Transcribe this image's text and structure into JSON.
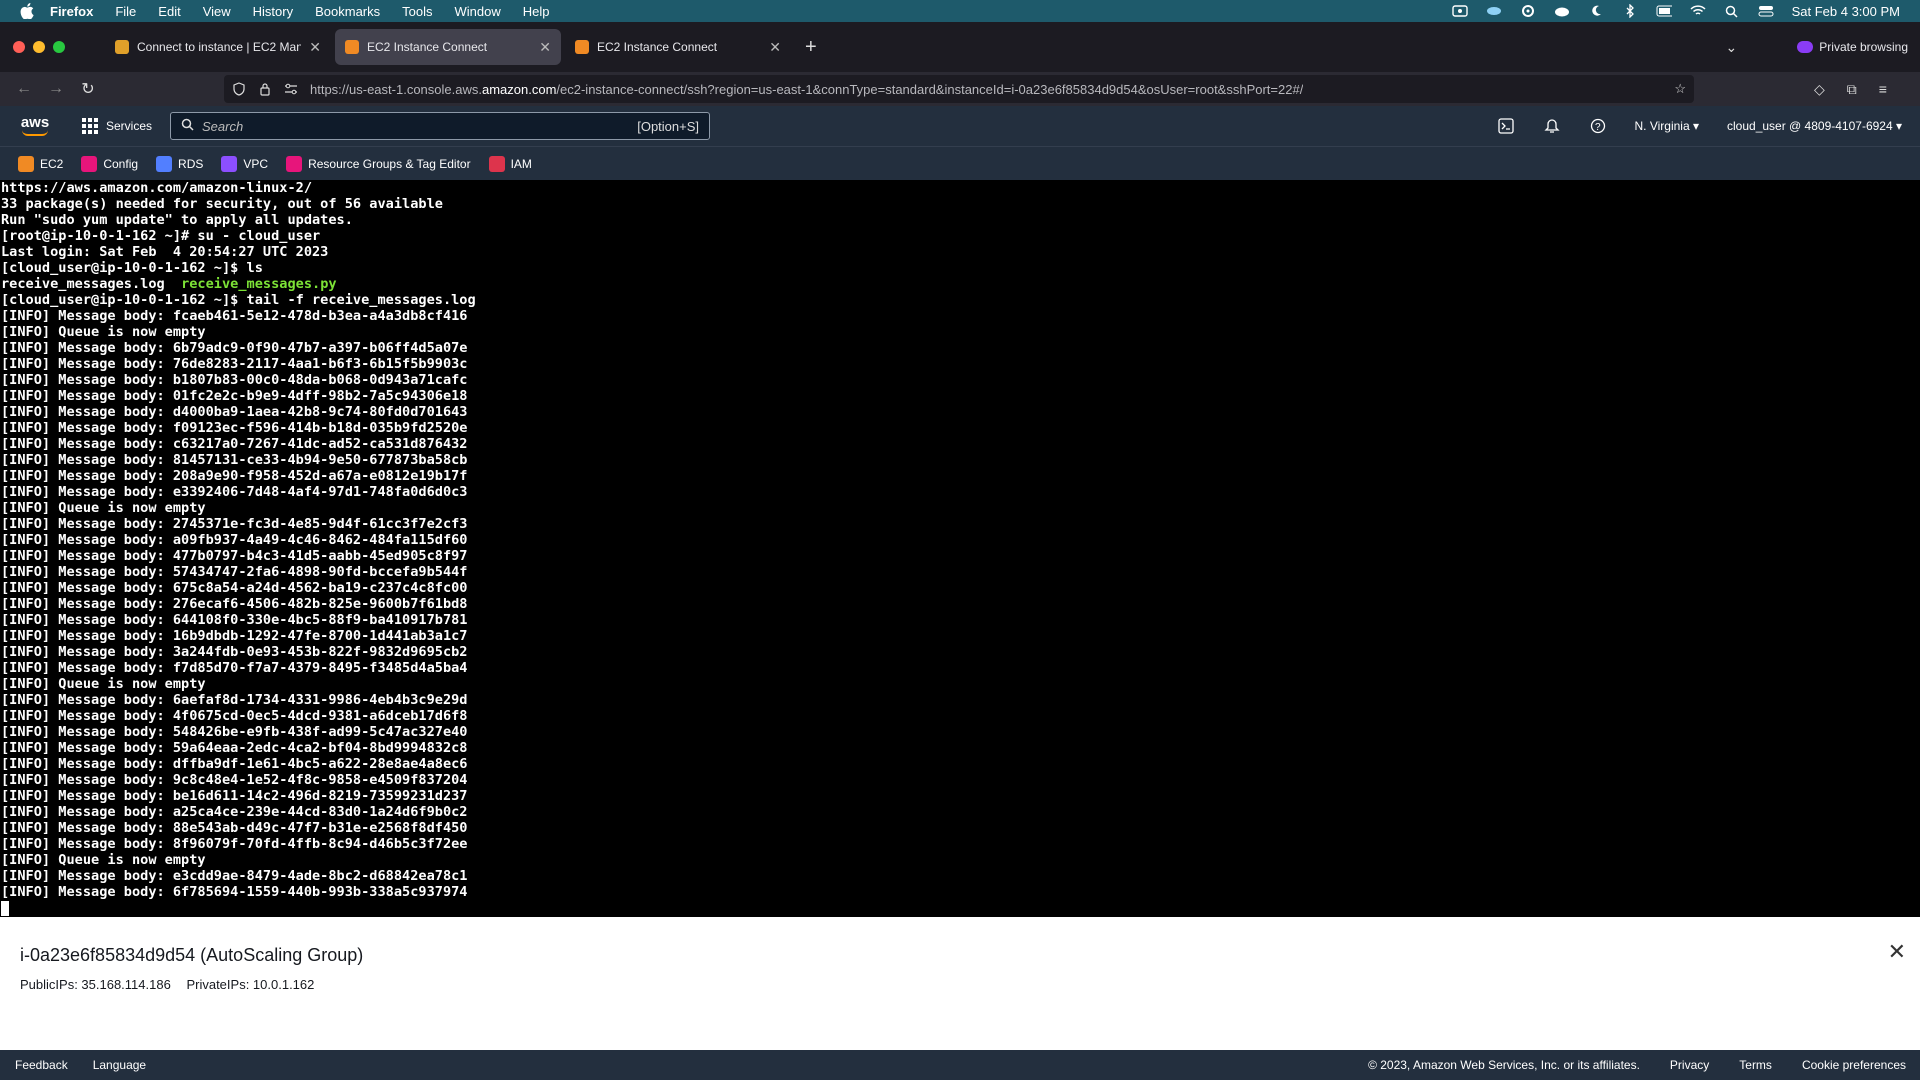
{
  "menubar": {
    "app": "Firefox",
    "items": [
      "File",
      "Edit",
      "View",
      "History",
      "Bookmarks",
      "Tools",
      "Window",
      "Help"
    ],
    "datetime": "Sat Feb 4  3:00 PM"
  },
  "tabs": [
    {
      "label": "Connect to instance | EC2 Mana",
      "active": false,
      "favicon_color": "#e0a02a"
    },
    {
      "label": "EC2 Instance Connect",
      "active": true,
      "favicon_color": "#f08a24"
    },
    {
      "label": "EC2 Instance Connect",
      "active": false,
      "favicon_color": "#f08a24"
    }
  ],
  "private_label": "Private browsing",
  "url": {
    "prefix": "https://us-east-1.console.aws.",
    "domain": "amazon.com",
    "path": "/ec2-instance-connect/ssh?region=us-east-1&connType=standard&instanceId=i-0a23e6f85834d9d54&osUser=root&sshPort=22#/"
  },
  "aws_header": {
    "logo_text": "aws",
    "services_label": "Services",
    "search_placeholder": "Search",
    "search_shortcut": "[Option+S]",
    "region": "N. Virginia ▾",
    "account": "cloud_user @ 4809-4107-6924 ▾"
  },
  "favorites": [
    {
      "label": "EC2",
      "color": "#f08a24"
    },
    {
      "label": "Config",
      "color": "#e7157b"
    },
    {
      "label": "RDS",
      "color": "#527fff"
    },
    {
      "label": "VPC",
      "color": "#8c4fff"
    },
    {
      "label": "Resource Groups & Tag Editor",
      "color": "#e7157b"
    },
    {
      "label": "IAM",
      "color": "#dd344c"
    }
  ],
  "terminal": {
    "pre_lines": [
      "https://aws.amazon.com/amazon-linux-2/",
      "33 package(s) needed for security, out of 56 available",
      "Run \"sudo yum update\" to apply all updates.",
      "[root@ip-10-0-1-162 ~]# su - cloud_user",
      "Last login: Sat Feb  4 20:54:27 UTC 2023",
      "[cloud_user@ip-10-0-1-162 ~]$ ls"
    ],
    "ls_file1": "receive_messages.log  ",
    "ls_file2": "receive_messages.py",
    "post_lines": [
      "[cloud_user@ip-10-0-1-162 ~]$ tail -f receive_messages.log",
      "[INFO] Message body: fcaeb461-5e12-478d-b3ea-a4a3db8cf416",
      "[INFO] Queue is now empty",
      "[INFO] Message body: 6b79adc9-0f90-47b7-a397-b06ff4d5a07e",
      "[INFO] Message body: 76de8283-2117-4aa1-b6f3-6b15f5b9903c",
      "[INFO] Message body: b1807b83-00c0-48da-b068-0d943a71cafc",
      "[INFO] Message body: 01fc2e2c-b9e9-4dff-98b2-7a5c94306e18",
      "[INFO] Message body: d4000ba9-1aea-42b8-9c74-80fd0d701643",
      "[INFO] Message body: f09123ec-f596-414b-b18d-035b9fd2520e",
      "[INFO] Message body: c63217a0-7267-41dc-ad52-ca531d876432",
      "[INFO] Message body: 81457131-ce33-4b94-9e50-677873ba58cb",
      "[INFO] Message body: 208a9e90-f958-452d-a67a-e0812e19b17f",
      "[INFO] Message body: e3392406-7d48-4af4-97d1-748fa0d6d0c3",
      "[INFO] Queue is now empty",
      "[INFO] Message body: 2745371e-fc3d-4e85-9d4f-61cc3f7e2cf3",
      "[INFO] Message body: a09fb937-4a49-4c46-8462-484fa115df60",
      "[INFO] Message body: 477b0797-b4c3-41d5-aabb-45ed905c8f97",
      "[INFO] Message body: 57434747-2fa6-4898-90fd-bccefa9b544f",
      "[INFO] Message body: 675c8a54-a24d-4562-ba19-c237c4c8fc00",
      "[INFO] Message body: 276ecaf6-4506-482b-825e-9600b7f61bd8",
      "[INFO] Message body: 644108f0-330e-4bc5-88f9-ba410917b781",
      "[INFO] Message body: 16b9dbdb-1292-47fe-8700-1d441ab3a1c7",
      "[INFO] Message body: 3a244fdb-0e93-453b-822f-9832d9695cb2",
      "[INFO] Message body: f7d85d70-f7a7-4379-8495-f3485d4a5ba4",
      "[INFO] Queue is now empty",
      "[INFO] Message body: 6aefaf8d-1734-4331-9986-4eb4b3c9e29d",
      "[INFO] Message body: 4f0675cd-0ec5-4dcd-9381-a6dceb17d6f8",
      "[INFO] Message body: 548426be-e9fb-438f-ad99-5c47ac327e40",
      "[INFO] Message body: 59a64eaa-2edc-4ca2-bf04-8bd9994832c8",
      "[INFO] Message body: dffba9df-1e61-4bc5-a622-28e8ae4a8ec6",
      "[INFO] Message body: 9c8c48e4-1e52-4f8c-9858-e4509f837204",
      "[INFO] Message body: be16d611-14c2-496d-8219-73599231d237",
      "[INFO] Message body: a25ca4ce-239e-44cd-83d0-1a24d6f9b0c2",
      "[INFO] Message body: 88e543ab-d49c-47f7-b31e-e2568f8df450",
      "[INFO] Message body: 8f96079f-70fd-4ffb-8c94-d46b5c3f72ee",
      "[INFO] Queue is now empty",
      "[INFO] Message body: e3cdd9ae-8479-4ade-8bc2-d68842ea78c1",
      "[INFO] Message body: 6f785694-1559-440b-993b-338a5c937974"
    ]
  },
  "instance_panel": {
    "title": "i-0a23e6f85834d9d54 (AutoScaling Group)",
    "public_ips": "PublicIPs: 35.168.114.186",
    "private_ips": "PrivateIPs: 10.0.1.162"
  },
  "footer": {
    "feedback": "Feedback",
    "language": "Language",
    "copyright": "© 2023, Amazon Web Services, Inc. or its affiliates.",
    "privacy": "Privacy",
    "terms": "Terms",
    "cookie": "Cookie preferences"
  }
}
